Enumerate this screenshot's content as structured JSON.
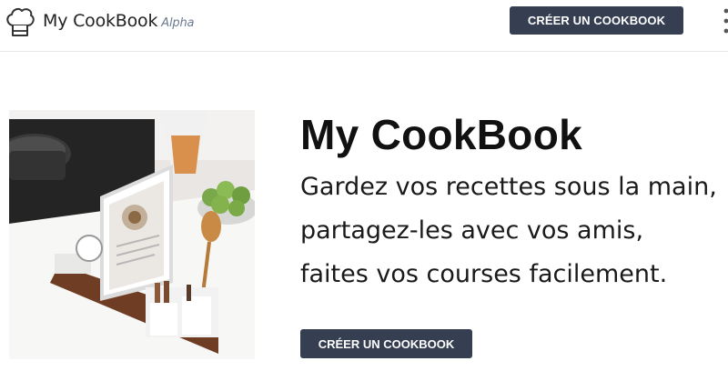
{
  "navbar": {
    "logo_icon": "chef-hat-icon",
    "brand_name": "My CookBook",
    "brand_tag": "Alpha",
    "cta_label": "CRÉER UN COOKBOOK",
    "menu_icon": "vertical-dots-menu-icon"
  },
  "hero": {
    "image_icon": "kitchen-tablet-recipe-photo",
    "title": "My CookBook",
    "tagline": [
      "Gardez vos recettes sous la main,",
      "partagez-les avec vos amis,",
      "faites vos courses facilement."
    ],
    "cta_label": "CRÉER UN COOKBOOK"
  },
  "colors": {
    "button_bg": "#363e52",
    "button_text": "#ffffff",
    "brand_tag": "#6b7a8f"
  }
}
